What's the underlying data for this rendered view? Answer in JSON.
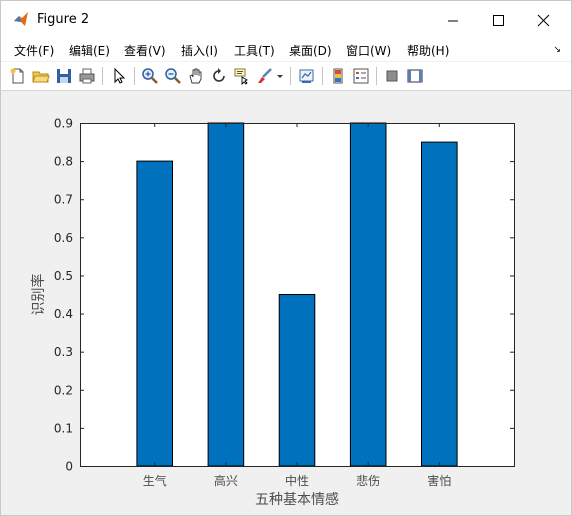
{
  "window": {
    "title": "Figure 2"
  },
  "menu": [
    {
      "label": "文件(F)"
    },
    {
      "label": "编辑(E)"
    },
    {
      "label": "查看(V)"
    },
    {
      "label": "插入(I)"
    },
    {
      "label": "工具(T)"
    },
    {
      "label": "桌面(D)"
    },
    {
      "label": "窗口(W)"
    },
    {
      "label": "帮助(H)"
    }
  ],
  "toolbar_icons": [
    "new-figure-icon",
    "open-file-icon",
    "save-icon",
    "print-icon",
    "select-arrow-icon",
    "zoom-in-icon",
    "zoom-out-icon",
    "pan-icon",
    "rotate-3d-icon",
    "data-cursor-icon",
    "brush-icon",
    "dropdown-arrow-icon",
    "link-plot-icon",
    "colorbar-icon",
    "legend-icon",
    "hide-plot-tools-icon",
    "show-plot-tools-icon"
  ],
  "colors": {
    "bar": "#0072BD",
    "figure_bg": "#f0f0f0",
    "axes_bg": "#ffffff"
  },
  "chart_data": {
    "type": "bar",
    "categories": [
      "生气",
      "高兴",
      "中性",
      "悲伤",
      "害怕"
    ],
    "values": [
      0.8,
      0.9,
      0.45,
      0.9,
      0.85
    ],
    "title": "",
    "xlabel": "五种基本情感",
    "ylabel": "识别率",
    "ylim": [
      0,
      0.9
    ],
    "yticks": [
      "0",
      "0.1",
      "0.2",
      "0.3",
      "0.4",
      "0.5",
      "0.6",
      "0.7",
      "0.8",
      "0.9"
    ],
    "grid": false,
    "legend": "none"
  }
}
